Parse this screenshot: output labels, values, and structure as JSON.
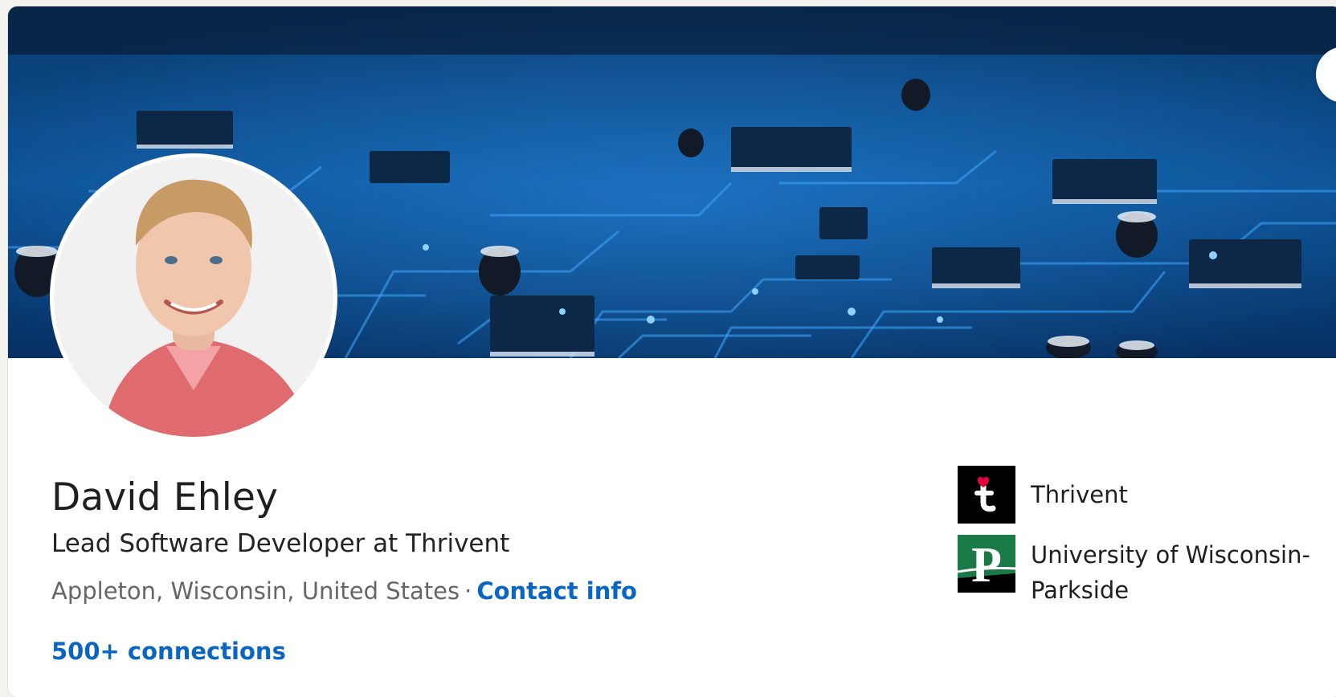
{
  "profile": {
    "name": "David Ehley",
    "headline": "Lead Software Developer at Thrivent",
    "location": "Appleton, Wisconsin, United States",
    "separator": "·",
    "contact_info_label": "Contact info",
    "connections_label": "500+ connections"
  },
  "organizations": [
    {
      "name": "Thrivent",
      "logo_icon": "thrivent-logo-icon",
      "logo_letter": "t"
    },
    {
      "name": "University of Wisconsin-Parkside",
      "logo_icon": "uw-parkside-logo-icon",
      "logo_letter": "P"
    }
  ],
  "colors": {
    "link": "#0a66c2",
    "banner": "#052a55",
    "thrivent_accent": "#e4003b",
    "parkside_green": "#1a7a46"
  }
}
